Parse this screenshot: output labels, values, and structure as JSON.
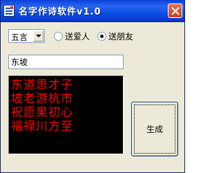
{
  "window": {
    "title": "名字作诗软件v1.0"
  },
  "form": {
    "poem_type": {
      "selected": "五言"
    },
    "recipients": [
      {
        "label": "送爱人",
        "checked": false
      },
      {
        "label": "送朋友",
        "checked": true
      }
    ],
    "name_value": "东坡"
  },
  "poem": {
    "lines": [
      "东道思才子",
      "坡老游杭市",
      "祝愿果初心",
      "福禄川方至"
    ],
    "text_color": "#ff0000",
    "background": "#000000"
  },
  "actions": {
    "generate_label": "生成"
  },
  "icons": {
    "app": "app-icon",
    "close": "close-icon"
  }
}
